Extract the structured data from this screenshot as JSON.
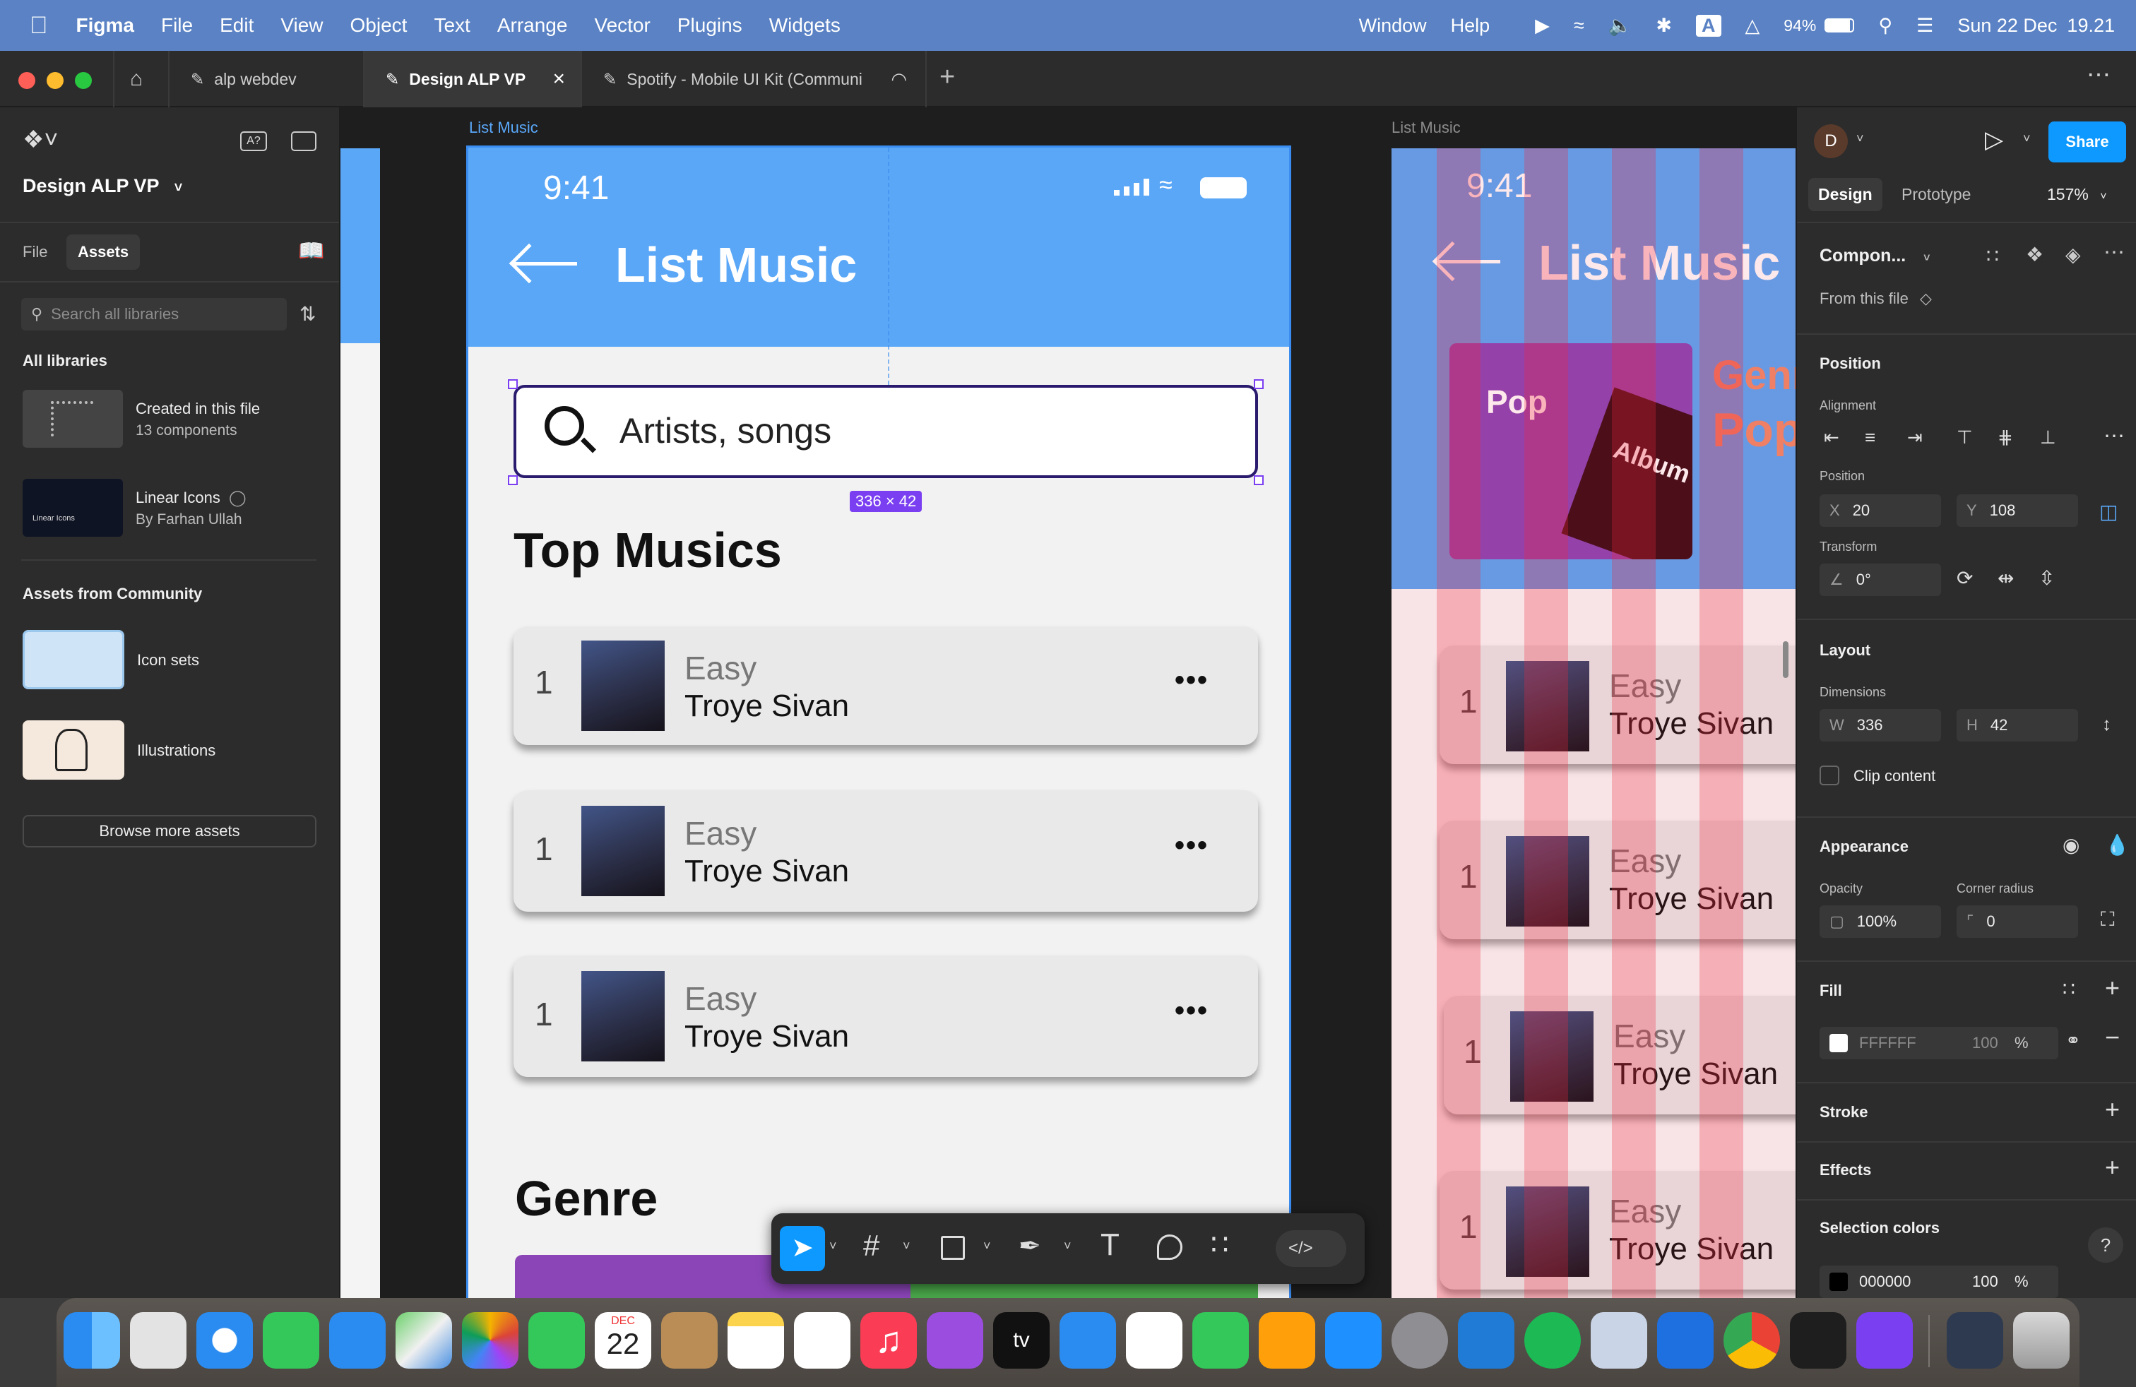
{
  "menubar": {
    "app": "Figma",
    "items": [
      "File",
      "Edit",
      "View",
      "Object",
      "Text",
      "Arrange",
      "Vector",
      "Plugins",
      "Widgets"
    ],
    "right_items": [
      "Window",
      "Help"
    ],
    "battery": "94%",
    "date": "Sun 22 Dec",
    "time": "19.21"
  },
  "tabs": [
    {
      "label": "alp webdev"
    },
    {
      "label": "Design ALP VP"
    },
    {
      "label": "Spotify - Mobile UI Kit (Communi"
    }
  ],
  "left": {
    "file_title": "Design ALP VP",
    "tab_file": "File",
    "tab_assets": "Assets",
    "search_placeholder": "Search all libraries",
    "all_libraries": "All libraries",
    "libs": [
      {
        "name": "Created in this file",
        "sub": "13 components"
      },
      {
        "name": "Linear Icons",
        "sub": "By Farhan Ullah",
        "thumb_text": "Linear Icons"
      }
    ],
    "community_title": "Assets from Community",
    "community": [
      {
        "name": "Icon sets"
      },
      {
        "name": "Illustrations"
      }
    ],
    "browse": "Browse more assets"
  },
  "canvas": {
    "frame1_label": "List Music",
    "frame2_label": "List Music",
    "phone": {
      "time": "9:41",
      "title": "List Music",
      "search_text": "Artists, songs",
      "size_badge": "336 × 42",
      "top_musics": "Top Musics",
      "genre": "Genre",
      "songs": [
        {
          "rank": "1",
          "title": "Easy",
          "artist": "Troye Sivan"
        },
        {
          "rank": "1",
          "title": "Easy",
          "artist": "Troye Sivan"
        },
        {
          "rank": "1",
          "title": "Easy",
          "artist": "Troye Sivan"
        }
      ]
    },
    "phone2": {
      "time": "9:41",
      "title": "List Music",
      "pop": "Pop",
      "album": "Album",
      "genre_text": "Genr",
      "pop2": "Pop",
      "songs": [
        {
          "rank": "1",
          "title": "Easy",
          "artist": "Troye Sivan"
        },
        {
          "rank": "1",
          "title": "Easy",
          "artist": "Troye Sivan"
        },
        {
          "rank": "1",
          "title": "Easy",
          "artist": "Troye Sivan"
        },
        {
          "rank": "1",
          "title": "Easy",
          "artist": "Troye Sivan"
        }
      ]
    }
  },
  "right": {
    "avatar": "D",
    "share": "Share",
    "tab_design": "Design",
    "tab_prototype": "Prototype",
    "zoom": "157%",
    "component": "Compon...",
    "from_file": "From this file",
    "position_title": "Position",
    "alignment": "Alignment",
    "position_label": "Position",
    "x_label": "X",
    "x": "20",
    "y_label": "Y",
    "y": "108",
    "transform": "Transform",
    "rotation": "0°",
    "layout_title": "Layout",
    "dimensions": "Dimensions",
    "w_label": "W",
    "w": "336",
    "h_label": "H",
    "h": "42",
    "clip": "Clip content",
    "appearance": "Appearance",
    "opacity_label": "Opacity",
    "opacity": "100%",
    "radius_label": "Corner radius",
    "radius": "0",
    "fill_title": "Fill",
    "fill_hex": "FFFFFF",
    "fill_opacity": "100",
    "pct": "%",
    "stroke": "Stroke",
    "effects": "Effects",
    "selection_colors": "Selection colors",
    "sel_hex": "000000",
    "sel_opacity": "100",
    "sel_pct": "%"
  },
  "dock": {
    "calendar_month": "DEC",
    "calendar_day": "22",
    "tv_label": "tv"
  },
  "colors": {
    "phone_blue": "#5aa7f7",
    "selection": "#2a1b6e",
    "badge": "#7b3ff2",
    "menubar": "#5a82c4",
    "share": "#0d99ff"
  }
}
